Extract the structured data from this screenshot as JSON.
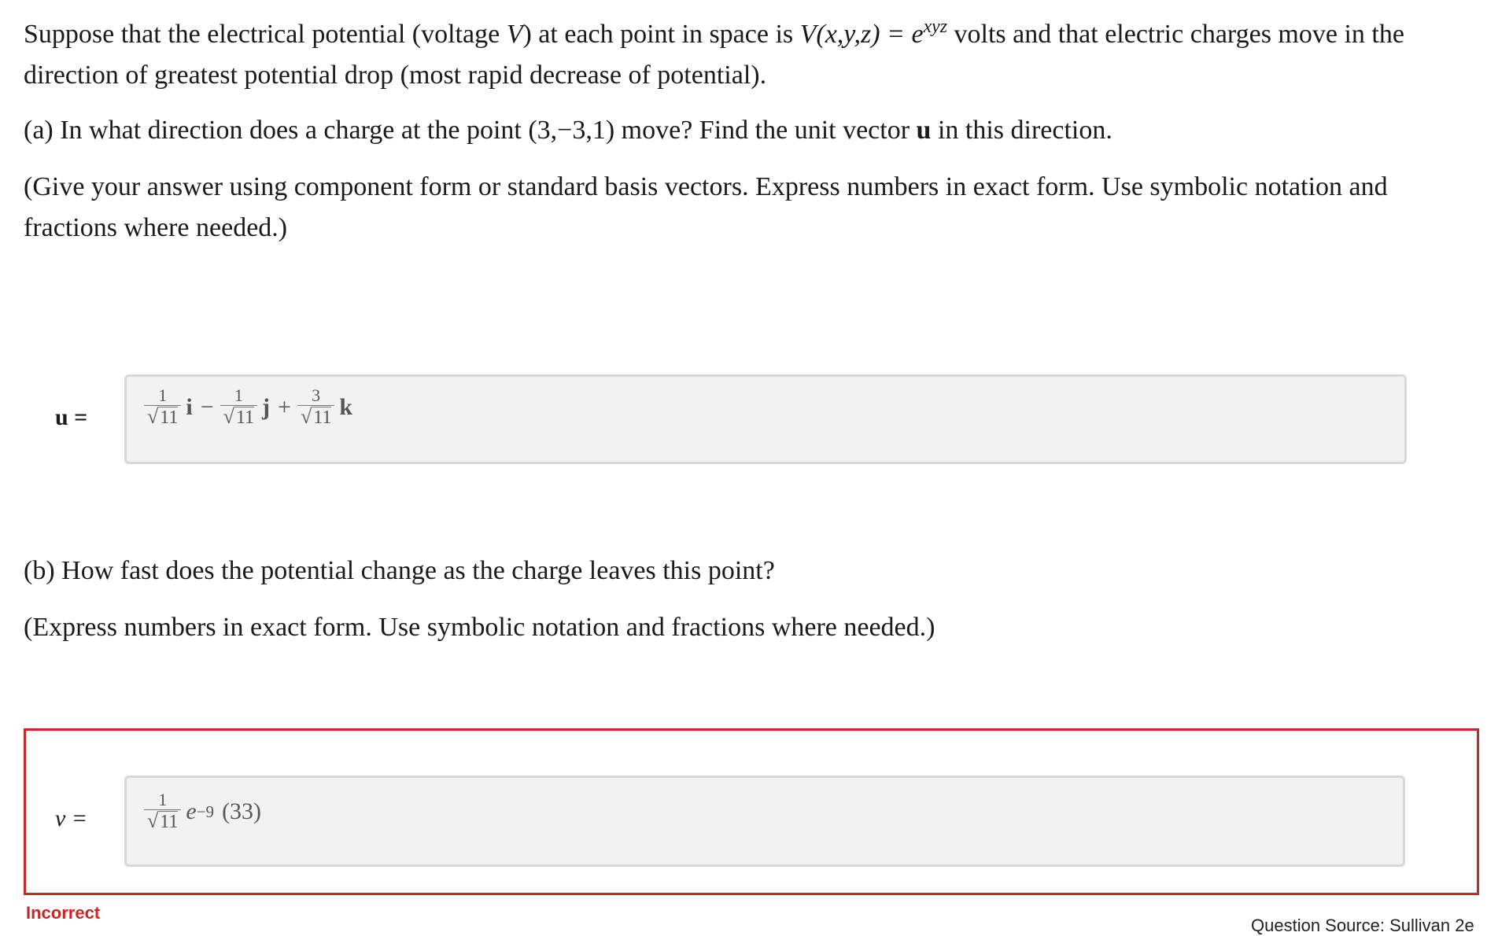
{
  "problem": {
    "intro_1": "Suppose that the electrical potential (voltage ",
    "intro_V": "V",
    "intro_2": ") at each point in space is ",
    "intro_fn": "V(x,y,z) = e",
    "intro_exp": "xyz",
    "intro_3": " volts and that electric charges move in the direction of greatest potential drop (most rapid decrease of potential).",
    "part_a_1": "(a) In what direction does a charge at the point (3,−3,1) move? Find the unit vector ",
    "part_a_u": "u",
    "part_a_2": " in this direction.",
    "part_a_hint": "(Give your answer using component form or standard basis vectors. Express numbers in exact form. Use symbolic notation and fractions where needed.)",
    "part_b": "(b) How fast does the potential change as the charge leaves this point?",
    "part_b_hint": "(Express numbers in exact form. Use symbolic notation and fractions where needed.)"
  },
  "answer_u": {
    "label": "u =",
    "terms": [
      {
        "num": "1",
        "den": "11",
        "vec": "i",
        "op": "−"
      },
      {
        "num": "1",
        "den": "11",
        "vec": "j",
        "op": "+"
      },
      {
        "num": "3",
        "den": "11",
        "vec": "k",
        "op": ""
      }
    ]
  },
  "answer_v": {
    "label": "v =",
    "num": "1",
    "den": "11",
    "base": "e",
    "exp": "−9",
    "tail": "(33)"
  },
  "feedback": {
    "status": "Incorrect",
    "status_color": "#c62828"
  },
  "source": "Question Source: Sullivan 2e"
}
